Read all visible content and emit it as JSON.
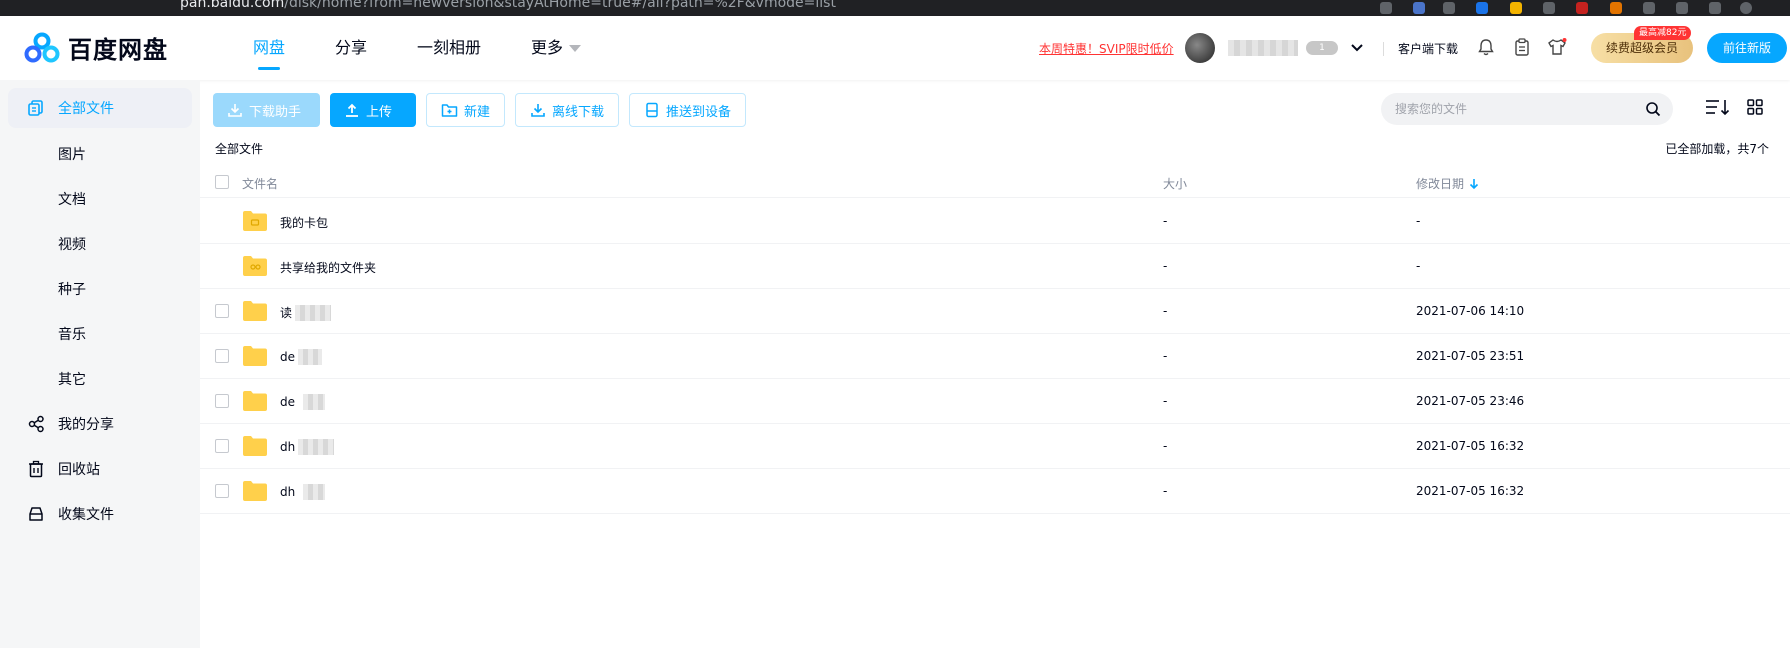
{
  "browser": {
    "url_host": "pan.baidu.com",
    "url_path": "/disk/home?from=newversion&stayAtHome=true#/all?path=%2F&vmode=list"
  },
  "header": {
    "logo_text": "百度网盘",
    "nav": [
      {
        "label": "网盘",
        "active": true
      },
      {
        "label": "分享",
        "active": false
      },
      {
        "label": "一刻相册",
        "active": false
      },
      {
        "label": "更多",
        "active": false
      }
    ],
    "promo_link": "本周特惠！SVIP限时低价",
    "vip_level": "1",
    "client_download": "客户端下载",
    "renew_button": "续费超级会员",
    "renew_tag": "最高减82元",
    "new_version_button": "前往新版"
  },
  "sidebar": {
    "items": [
      {
        "label": "全部文件",
        "icon": "all-files-icon",
        "active": true
      },
      {
        "label": "图片",
        "icon": "",
        "active": false
      },
      {
        "label": "文档",
        "icon": "",
        "active": false
      },
      {
        "label": "视频",
        "icon": "",
        "active": false
      },
      {
        "label": "种子",
        "icon": "",
        "active": false
      },
      {
        "label": "音乐",
        "icon": "",
        "active": false
      },
      {
        "label": "其它",
        "icon": "",
        "active": false
      },
      {
        "label": "我的分享",
        "icon": "share-icon",
        "active": false
      },
      {
        "label": "回收站",
        "icon": "trash-icon",
        "active": false
      },
      {
        "label": "收集文件",
        "icon": "collect-icon",
        "active": false
      }
    ]
  },
  "toolbar": {
    "download_helper": "下载助手",
    "upload": "上传",
    "new": "新建",
    "offline_download": "离线下载",
    "push_device": "推送到设备"
  },
  "search": {
    "placeholder": "搜索您的文件"
  },
  "breadcrumb": "全部文件",
  "load_status": "已全部加载，共7个",
  "table": {
    "headers": {
      "name": "文件名",
      "size": "大小",
      "date": "修改日期"
    },
    "rows": [
      {
        "name": "我的卡包",
        "size": "-",
        "date": "-",
        "special": true
      },
      {
        "name": "共享给我的文件夹",
        "size": "-",
        "date": "-",
        "special": true
      },
      {
        "name": "读",
        "size": "-",
        "date": "2021-07-06 14:10",
        "special": false
      },
      {
        "name": "de",
        "size": "-",
        "date": "2021-07-05 23:51",
        "special": false
      },
      {
        "name": "de",
        "size": "-",
        "date": "2021-07-05 23:46",
        "special": false
      },
      {
        "name": "dh",
        "size": "-",
        "date": "2021-07-05 16:32",
        "special": false
      },
      {
        "name": "dh",
        "size": "-",
        "date": "2021-07-05 16:32",
        "special": false
      }
    ]
  },
  "colors": {
    "accent": "#06a7ff",
    "promo": "#ff3333",
    "folder": "#ffd04b"
  }
}
